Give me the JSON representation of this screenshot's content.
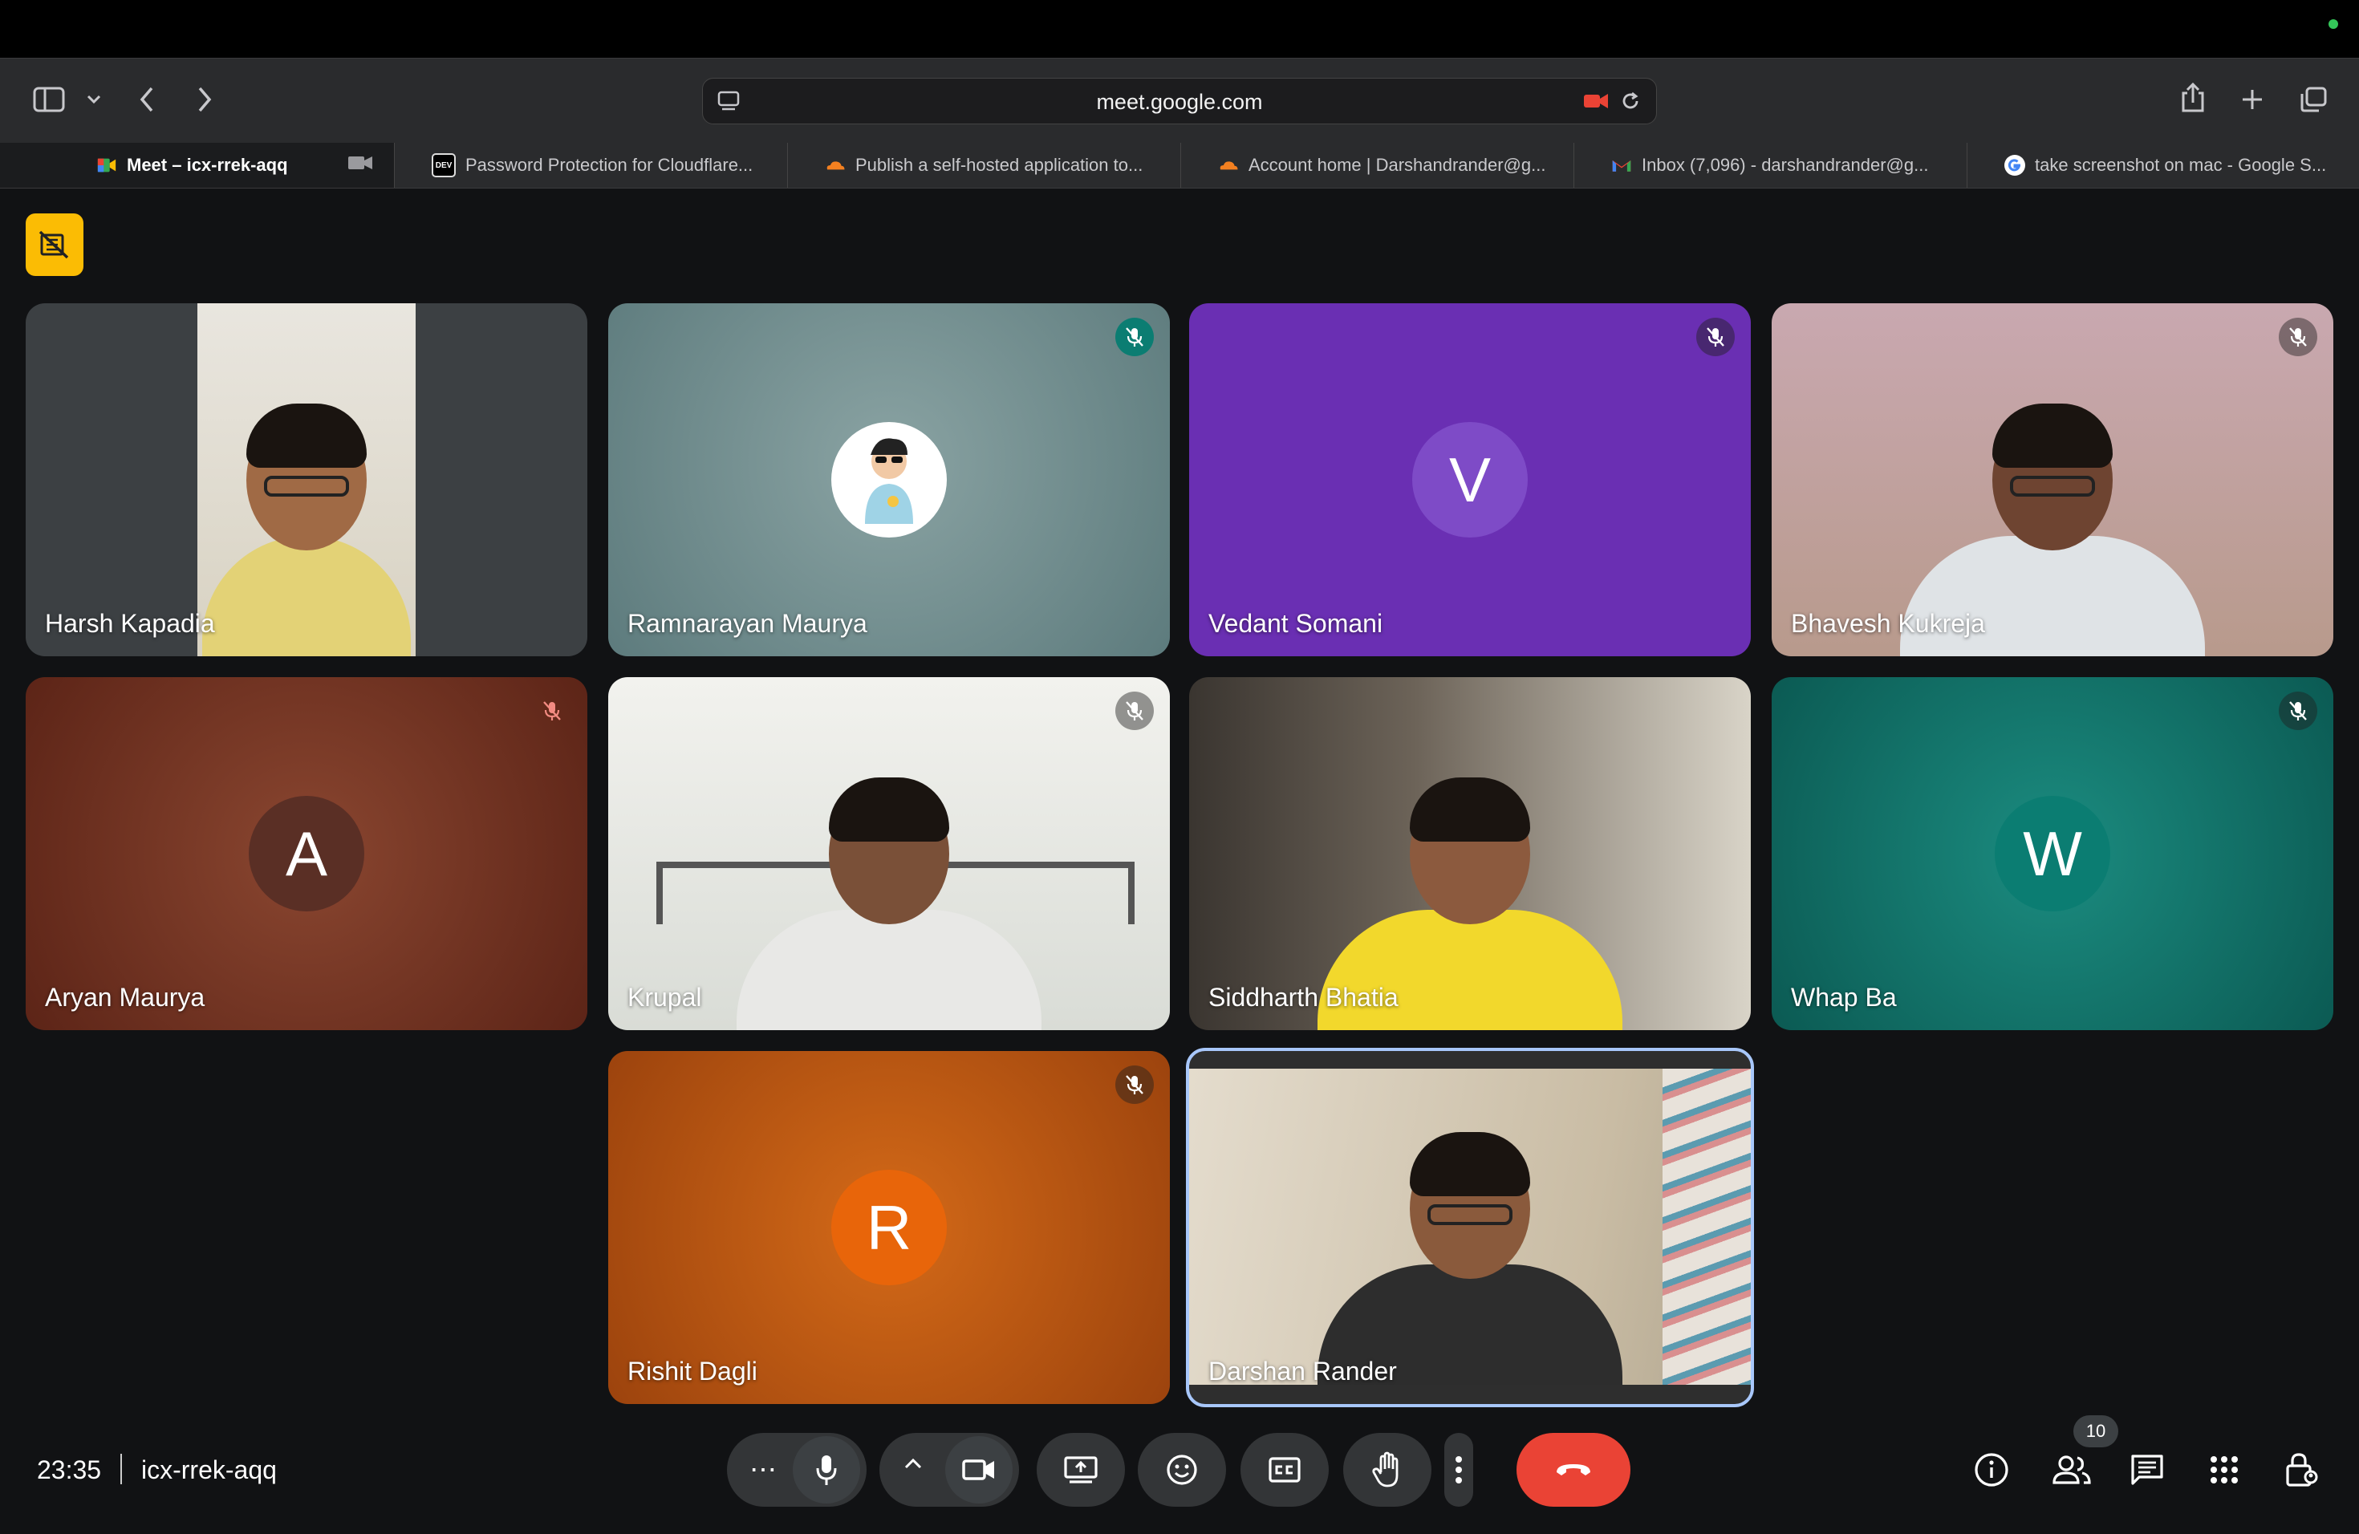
{
  "browser": {
    "url": "meet.google.com",
    "tabs": [
      {
        "label": "Meet – icx-rrek-aqq",
        "favicon": "google-meet-icon",
        "active": true
      },
      {
        "label": "Password Protection for Cloudflare...",
        "favicon": "dev-icon",
        "active": false
      },
      {
        "label": "Publish a self-hosted application to...",
        "favicon": "cloudflare-icon",
        "active": false
      },
      {
        "label": "Account home | Darshandrander@g...",
        "favicon": "cloudflare-icon",
        "active": false
      },
      {
        "label": "Inbox (7,096) - darshandrander@g...",
        "favicon": "gmail-icon",
        "active": false
      },
      {
        "label": "take screenshot on mac - Google S...",
        "favicon": "google-icon",
        "active": false
      }
    ],
    "dev_favicon_text": "DEV"
  },
  "participants": [
    {
      "name": "Harsh Kapadia",
      "type": "video",
      "muted": false
    },
    {
      "name": "Ramnarayan Maurya",
      "type": "avatar-image",
      "muted": true,
      "bg": "#6f8a8c"
    },
    {
      "name": "Vedant Somani",
      "type": "avatar",
      "initial": "V",
      "muted": true,
      "bg": "#6a2fb3",
      "avatar_color": "#7e4bc7"
    },
    {
      "name": "Bhavesh Kukreja",
      "type": "video",
      "muted": true
    },
    {
      "name": "Aryan Maurya",
      "type": "avatar",
      "initial": "A",
      "muted": true,
      "bg": "#6b2e1f",
      "avatar_color": "#5a2f25"
    },
    {
      "name": "Krupal",
      "type": "video",
      "muted": true
    },
    {
      "name": "Siddharth Bhatia",
      "type": "video",
      "muted": false
    },
    {
      "name": "Whap Ba",
      "type": "avatar",
      "initial": "W",
      "muted": true,
      "bg": "#0d6b63",
      "avatar_color": "#0b7d72"
    },
    {
      "name": "Rishit Dagli",
      "type": "avatar",
      "initial": "R",
      "muted": true,
      "bg": "#c4560c",
      "avatar_color": "#e8650a"
    },
    {
      "name": "Darshan Rander",
      "type": "video",
      "muted": false,
      "self": true
    }
  ],
  "meeting": {
    "time": "23:35",
    "code": "icx-rrek-aqq",
    "participant_count": "10"
  },
  "colors": {
    "accent": "#fbbc04",
    "end_call": "#ea4335",
    "self_border": "#a8c7fa"
  }
}
